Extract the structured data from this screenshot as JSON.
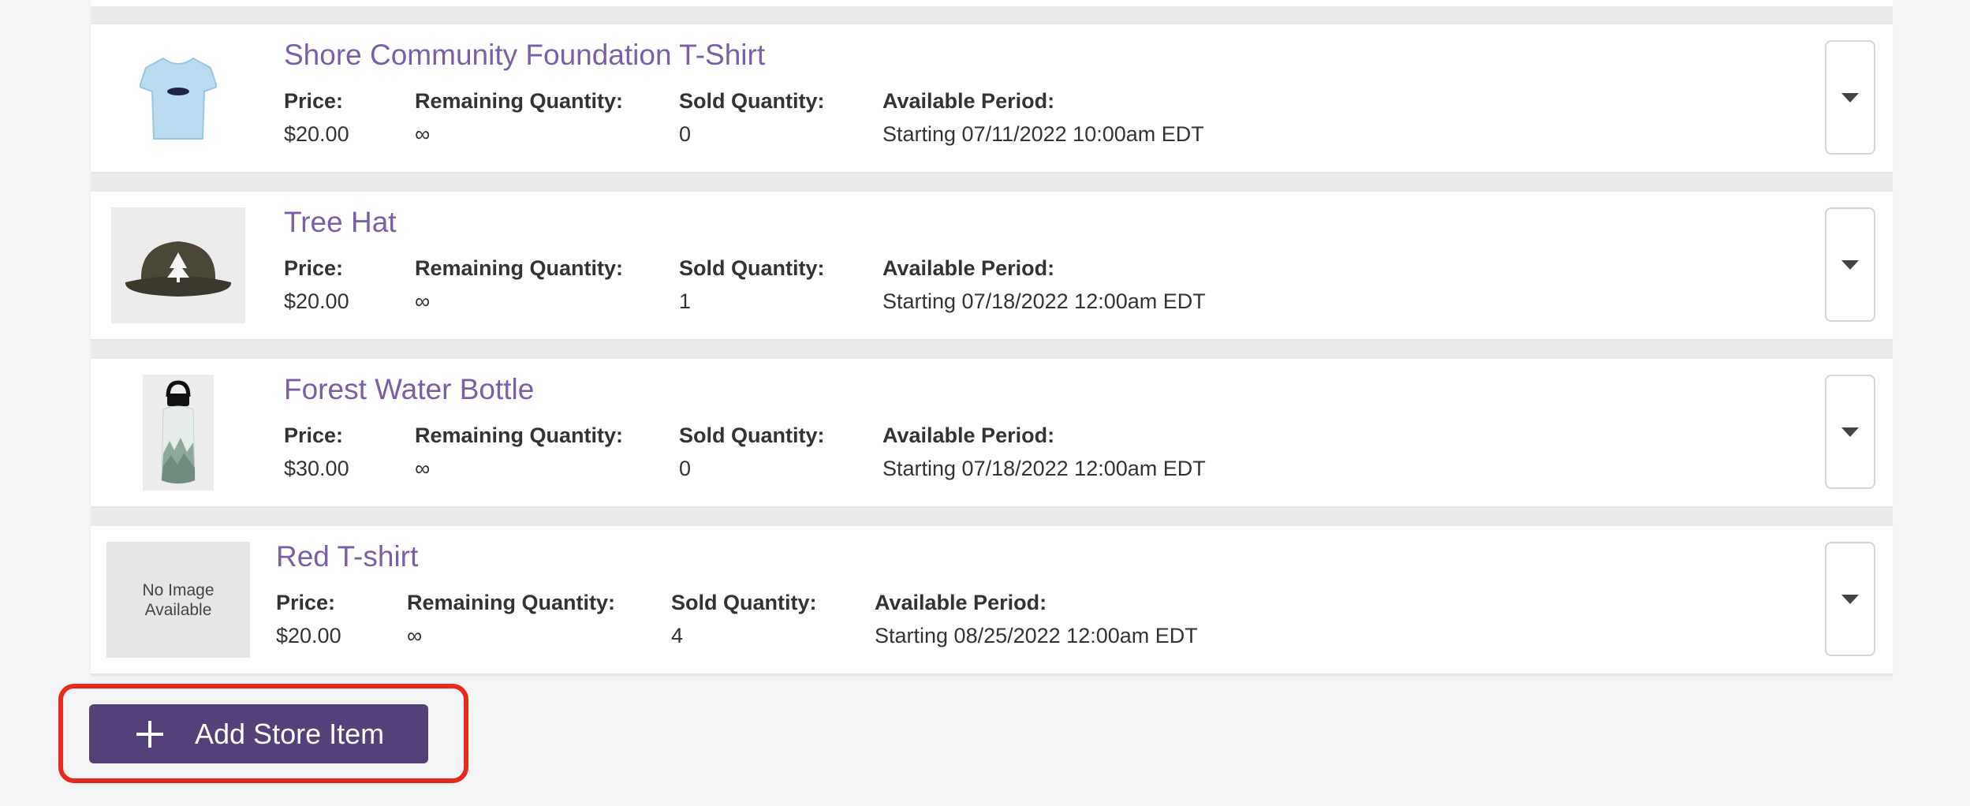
{
  "items": [
    {
      "name": "Shore Community Foundation T-Shirt",
      "image": "light-blue-tshirt",
      "price_label": "Price:",
      "price": "$20.00",
      "remaining_label": "Remaining Quantity:",
      "remaining": "∞",
      "sold_label": "Sold Quantity:",
      "sold": "0",
      "period_label": "Available Period:",
      "period": "Starting 07/11/2022 10:00am EDT"
    },
    {
      "name": "Tree Hat",
      "image": "dark-cap-with-tree",
      "price_label": "Price:",
      "price": "$20.00",
      "remaining_label": "Remaining Quantity:",
      "remaining": "∞",
      "sold_label": "Sold Quantity:",
      "sold": "1",
      "period_label": "Available Period:",
      "period": "Starting 07/18/2022 12:00am EDT"
    },
    {
      "name": "Forest Water Bottle",
      "image": "forest-print-bottle",
      "price_label": "Price:",
      "price": "$30.00",
      "remaining_label": "Remaining Quantity:",
      "remaining": "∞",
      "sold_label": "Sold Quantity:",
      "sold": "0",
      "period_label": "Available Period:",
      "period": "Starting 07/18/2022 12:00am EDT"
    },
    {
      "name": "Red T-shirt",
      "image_placeholder_line1": "No Image",
      "image_placeholder_line2": "Available",
      "price_label": "Price:",
      "price": "$20.00",
      "remaining_label": "Remaining Quantity:",
      "remaining": "∞",
      "sold_label": "Sold Quantity:",
      "sold": "4",
      "period_label": "Available Period:",
      "period": "Starting 08/25/2022 12:00am EDT"
    }
  ],
  "add_button": {
    "label": "Add Store Item",
    "icon": "plus-icon",
    "highlight_color": "#e8291c"
  },
  "colors": {
    "title": "#7a5fa8",
    "button": "#54417a",
    "background": "#f3f4f6"
  }
}
